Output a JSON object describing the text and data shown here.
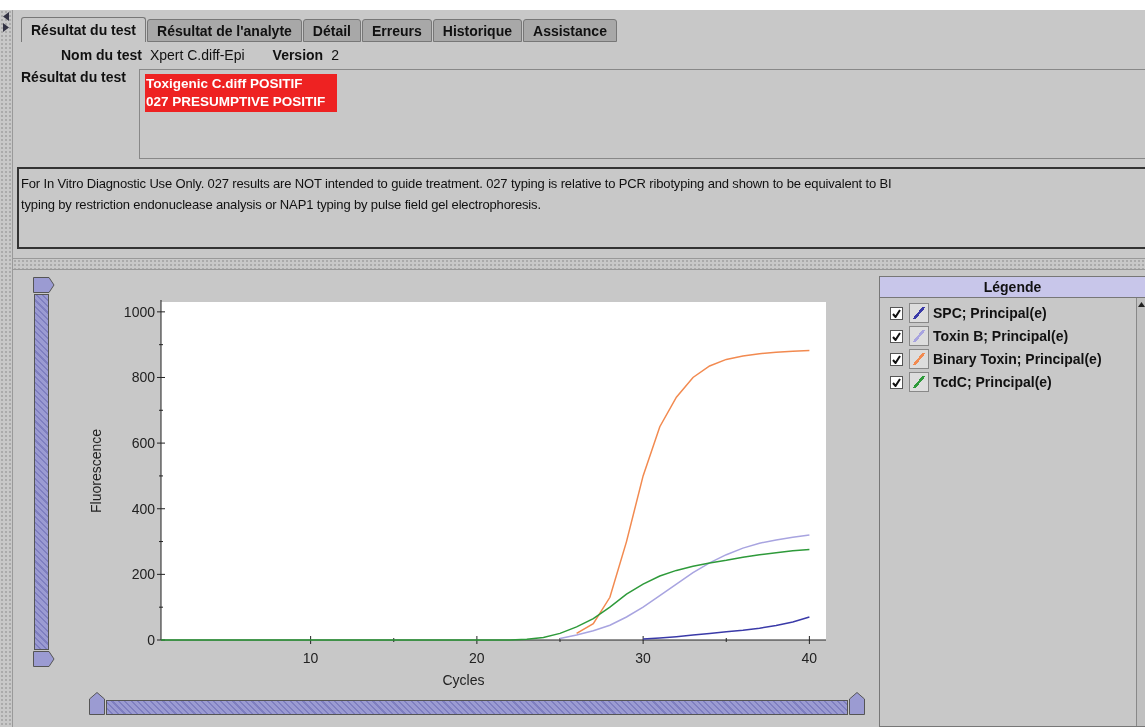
{
  "tabs": [
    {
      "label": "Résultat du test",
      "selected": true
    },
    {
      "label": "Résultat de l'analyte",
      "selected": false
    },
    {
      "label": "Détail",
      "selected": false
    },
    {
      "label": "Erreurs",
      "selected": false
    },
    {
      "label": "Historique",
      "selected": false
    },
    {
      "label": "Assistance",
      "selected": false
    }
  ],
  "test_info": {
    "name_label": "Nom du test",
    "name_value": "Xpert C.diff-Epi",
    "version_label": "Version",
    "version_value": "2"
  },
  "test_result": {
    "label": "Résultat du test",
    "lines": [
      "Toxigenic C.diff POSITIF",
      "027 PRESUMPTIVE POSITIF"
    ]
  },
  "notice": {
    "lines": [
      "For In Vitro Diagnostic Use Only. 027 results are NOT intended to guide treatment. 027 typing is relative to PCR ribotyping and shown to be equivalent to BI",
      "typing by restriction endonuclease analysis or NAP1 typing by pulse field gel electrophoresis."
    ]
  },
  "vertical_slider": {
    "level": 1
  },
  "chart": {
    "chart_data": {
      "type": "line",
      "xlabel": "Cycles",
      "ylabel": "Fluorescence",
      "x": [
        1,
        2,
        3,
        4,
        5,
        6,
        7,
        8,
        9,
        10,
        11,
        12,
        13,
        14,
        15,
        16,
        17,
        18,
        19,
        20,
        21,
        22,
        23,
        24,
        25,
        26,
        27,
        28,
        29,
        30,
        31,
        32,
        33,
        34,
        35,
        36,
        37,
        38,
        39,
        40
      ],
      "xlim": [
        1,
        41
      ],
      "ylim": [
        0,
        1030
      ],
      "xticks": [
        10,
        20,
        30,
        40
      ],
      "yticks": [
        0,
        200,
        400,
        600,
        800,
        1000
      ],
      "series": [
        {
          "name": "SPC; Principal(e)",
          "color": "#3a3aa8",
          "values": [
            null,
            null,
            null,
            null,
            null,
            null,
            null,
            null,
            null,
            null,
            null,
            null,
            null,
            null,
            null,
            null,
            null,
            null,
            null,
            null,
            null,
            null,
            null,
            null,
            null,
            null,
            null,
            null,
            null,
            3,
            6,
            10,
            15,
            20,
            25,
            30,
            36,
            44,
            55,
            70
          ]
        },
        {
          "name": "Toxin B; Principal(e)",
          "color": "#a8a4e0",
          "values": [
            null,
            null,
            null,
            null,
            null,
            null,
            null,
            null,
            null,
            null,
            null,
            null,
            null,
            null,
            null,
            null,
            null,
            null,
            null,
            null,
            null,
            null,
            null,
            null,
            5,
            15,
            28,
            45,
            70,
            100,
            135,
            170,
            205,
            235,
            260,
            280,
            295,
            305,
            313,
            320
          ]
        },
        {
          "name": "Binary Toxin; Principal(e)",
          "color": "#f28a50",
          "values": [
            null,
            null,
            null,
            null,
            null,
            null,
            null,
            null,
            null,
            null,
            null,
            null,
            null,
            null,
            null,
            null,
            null,
            null,
            null,
            null,
            null,
            null,
            null,
            null,
            null,
            20,
            50,
            130,
            300,
            500,
            650,
            740,
            800,
            835,
            855,
            865,
            872,
            877,
            880,
            882
          ]
        },
        {
          "name": "TcdC; Principal(e)",
          "color": "#2e9a3a",
          "values": [
            0,
            0,
            0,
            0,
            0,
            0,
            0,
            0,
            0,
            0,
            0,
            0,
            0,
            0,
            0,
            0,
            0,
            0,
            0,
            0,
            0,
            0,
            2,
            8,
            20,
            40,
            65,
            100,
            140,
            170,
            195,
            212,
            225,
            235,
            243,
            252,
            260,
            266,
            272,
            276
          ]
        }
      ]
    }
  },
  "horizontal_slider": {
    "level": 1
  },
  "legend": {
    "title": "Légende",
    "items": [
      {
        "checked": true
      },
      {
        "checked": true
      },
      {
        "checked": true
      },
      {
        "checked": true
      }
    ]
  }
}
